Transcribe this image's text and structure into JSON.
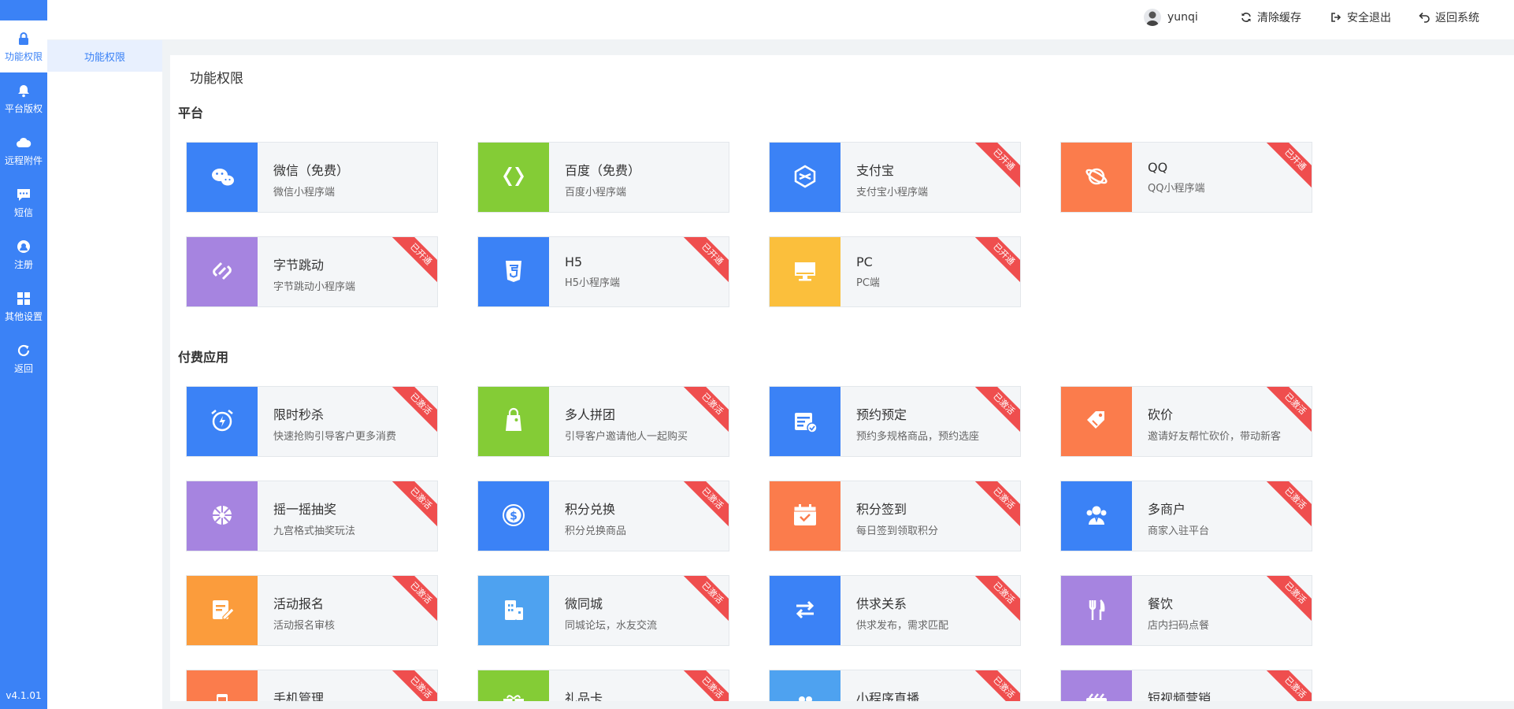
{
  "sidebar": {
    "items": [
      {
        "label": "功能权限",
        "icon": "lock-icon",
        "active": true
      },
      {
        "label": "平台版权",
        "icon": "bell-icon"
      },
      {
        "label": "远程附件",
        "icon": "cloud-icon"
      },
      {
        "label": "短信",
        "icon": "chat-icon"
      },
      {
        "label": "注册",
        "icon": "headset-icon"
      },
      {
        "label": "其他设置",
        "icon": "grid-icon"
      },
      {
        "label": "返回",
        "icon": "refresh-icon"
      }
    ],
    "version": "v4.1.01"
  },
  "header": {
    "username": "yunqi",
    "clear_cache": "清除缓存",
    "logout": "安全退出",
    "back_system": "返回系统"
  },
  "submenu": {
    "item": "功能权限"
  },
  "main": {
    "title": "功能权限",
    "platform_title": "平台",
    "paid_title": "付费应用",
    "platforms": [
      {
        "name": "微信（免费）",
        "desc": "微信小程序端",
        "color": "#3b82f6",
        "icon": "wechat-icon",
        "ribbon": ""
      },
      {
        "name": "百度（免费）",
        "desc": "百度小程序端",
        "color": "#84cc36",
        "icon": "baidu-icon",
        "ribbon": ""
      },
      {
        "name": "支付宝",
        "desc": "支付宝小程序端",
        "color": "#3b82f6",
        "icon": "alipay-icon",
        "ribbon": "已开通"
      },
      {
        "name": "QQ",
        "desc": "QQ小程序端",
        "color": "#fb7c4c",
        "icon": "qq-icon",
        "ribbon": "已开通"
      },
      {
        "name": "字节跳动",
        "desc": "字节跳动小程序端",
        "color": "#a684e0",
        "icon": "bytedance-icon",
        "ribbon": "已开通"
      },
      {
        "name": "H5",
        "desc": "H5小程序端",
        "color": "#3b82f6",
        "icon": "html5-icon",
        "ribbon": "已开通"
      },
      {
        "name": "PC",
        "desc": "PC端",
        "color": "#fbbf3c",
        "icon": "monitor-icon",
        "ribbon": "已开通"
      }
    ],
    "apps": [
      {
        "name": "限时秒杀",
        "desc": "快速抢购引导客户更多消费",
        "color": "#3b82f6",
        "icon": "alarm-clock-icon",
        "ribbon": "已激活"
      },
      {
        "name": "多人拼团",
        "desc": "引导客户邀请他人一起购买",
        "color": "#84cc36",
        "icon": "bag-icon",
        "ribbon": "已激活"
      },
      {
        "name": "预约预定",
        "desc": "预约多规格商品，预约选座",
        "color": "#3b82f6",
        "icon": "calendar-check-icon",
        "ribbon": "已激活"
      },
      {
        "name": "砍价",
        "desc": "邀请好友帮忙砍价，带动新客",
        "color": "#fb7c4c",
        "icon": "price-tag-icon",
        "ribbon": "已激活"
      },
      {
        "name": "摇一摇抽奖",
        "desc": "九宫格式抽奖玩法",
        "color": "#a684e0",
        "icon": "wheel-icon",
        "ribbon": "已激活"
      },
      {
        "name": "积分兑换",
        "desc": "积分兑换商品",
        "color": "#3b82f6",
        "icon": "coin-icon",
        "ribbon": "已激活"
      },
      {
        "name": "积分签到",
        "desc": "每日签到领取积分",
        "color": "#fb7c4c",
        "icon": "calendar-tick-icon",
        "ribbon": "已激活"
      },
      {
        "name": "多商户",
        "desc": "商家入驻平台",
        "color": "#3b82f6",
        "icon": "users-icon",
        "ribbon": "已激活"
      },
      {
        "name": "活动报名",
        "desc": "活动报名审核",
        "color": "#fb9c3c",
        "icon": "edit-form-icon",
        "ribbon": "已激活"
      },
      {
        "name": "微同城",
        "desc": "同城论坛，水友交流",
        "color": "#4ea2f0",
        "icon": "building-icon",
        "ribbon": "已激活"
      },
      {
        "name": "供求关系",
        "desc": "供求发布，需求匹配",
        "color": "#3b82f6",
        "icon": "exchange-icon",
        "ribbon": "已激活"
      },
      {
        "name": "餐饮",
        "desc": "店内扫码点餐",
        "color": "#a684e0",
        "icon": "fork-knife-icon",
        "ribbon": "已激活"
      },
      {
        "name": "手机管理",
        "desc": "",
        "color": "#fb7c4c",
        "icon": "phone-icon",
        "ribbon": "已激活"
      },
      {
        "name": "礼品卡",
        "desc": "",
        "color": "#84cc36",
        "icon": "gift-icon",
        "ribbon": "已激活"
      },
      {
        "name": "小程序直播",
        "desc": "",
        "color": "#4ea2f0",
        "icon": "live-icon",
        "ribbon": "已激活"
      },
      {
        "name": "短视频营销",
        "desc": "",
        "color": "#a684e0",
        "icon": "video-icon",
        "ribbon": "已激活"
      }
    ]
  }
}
